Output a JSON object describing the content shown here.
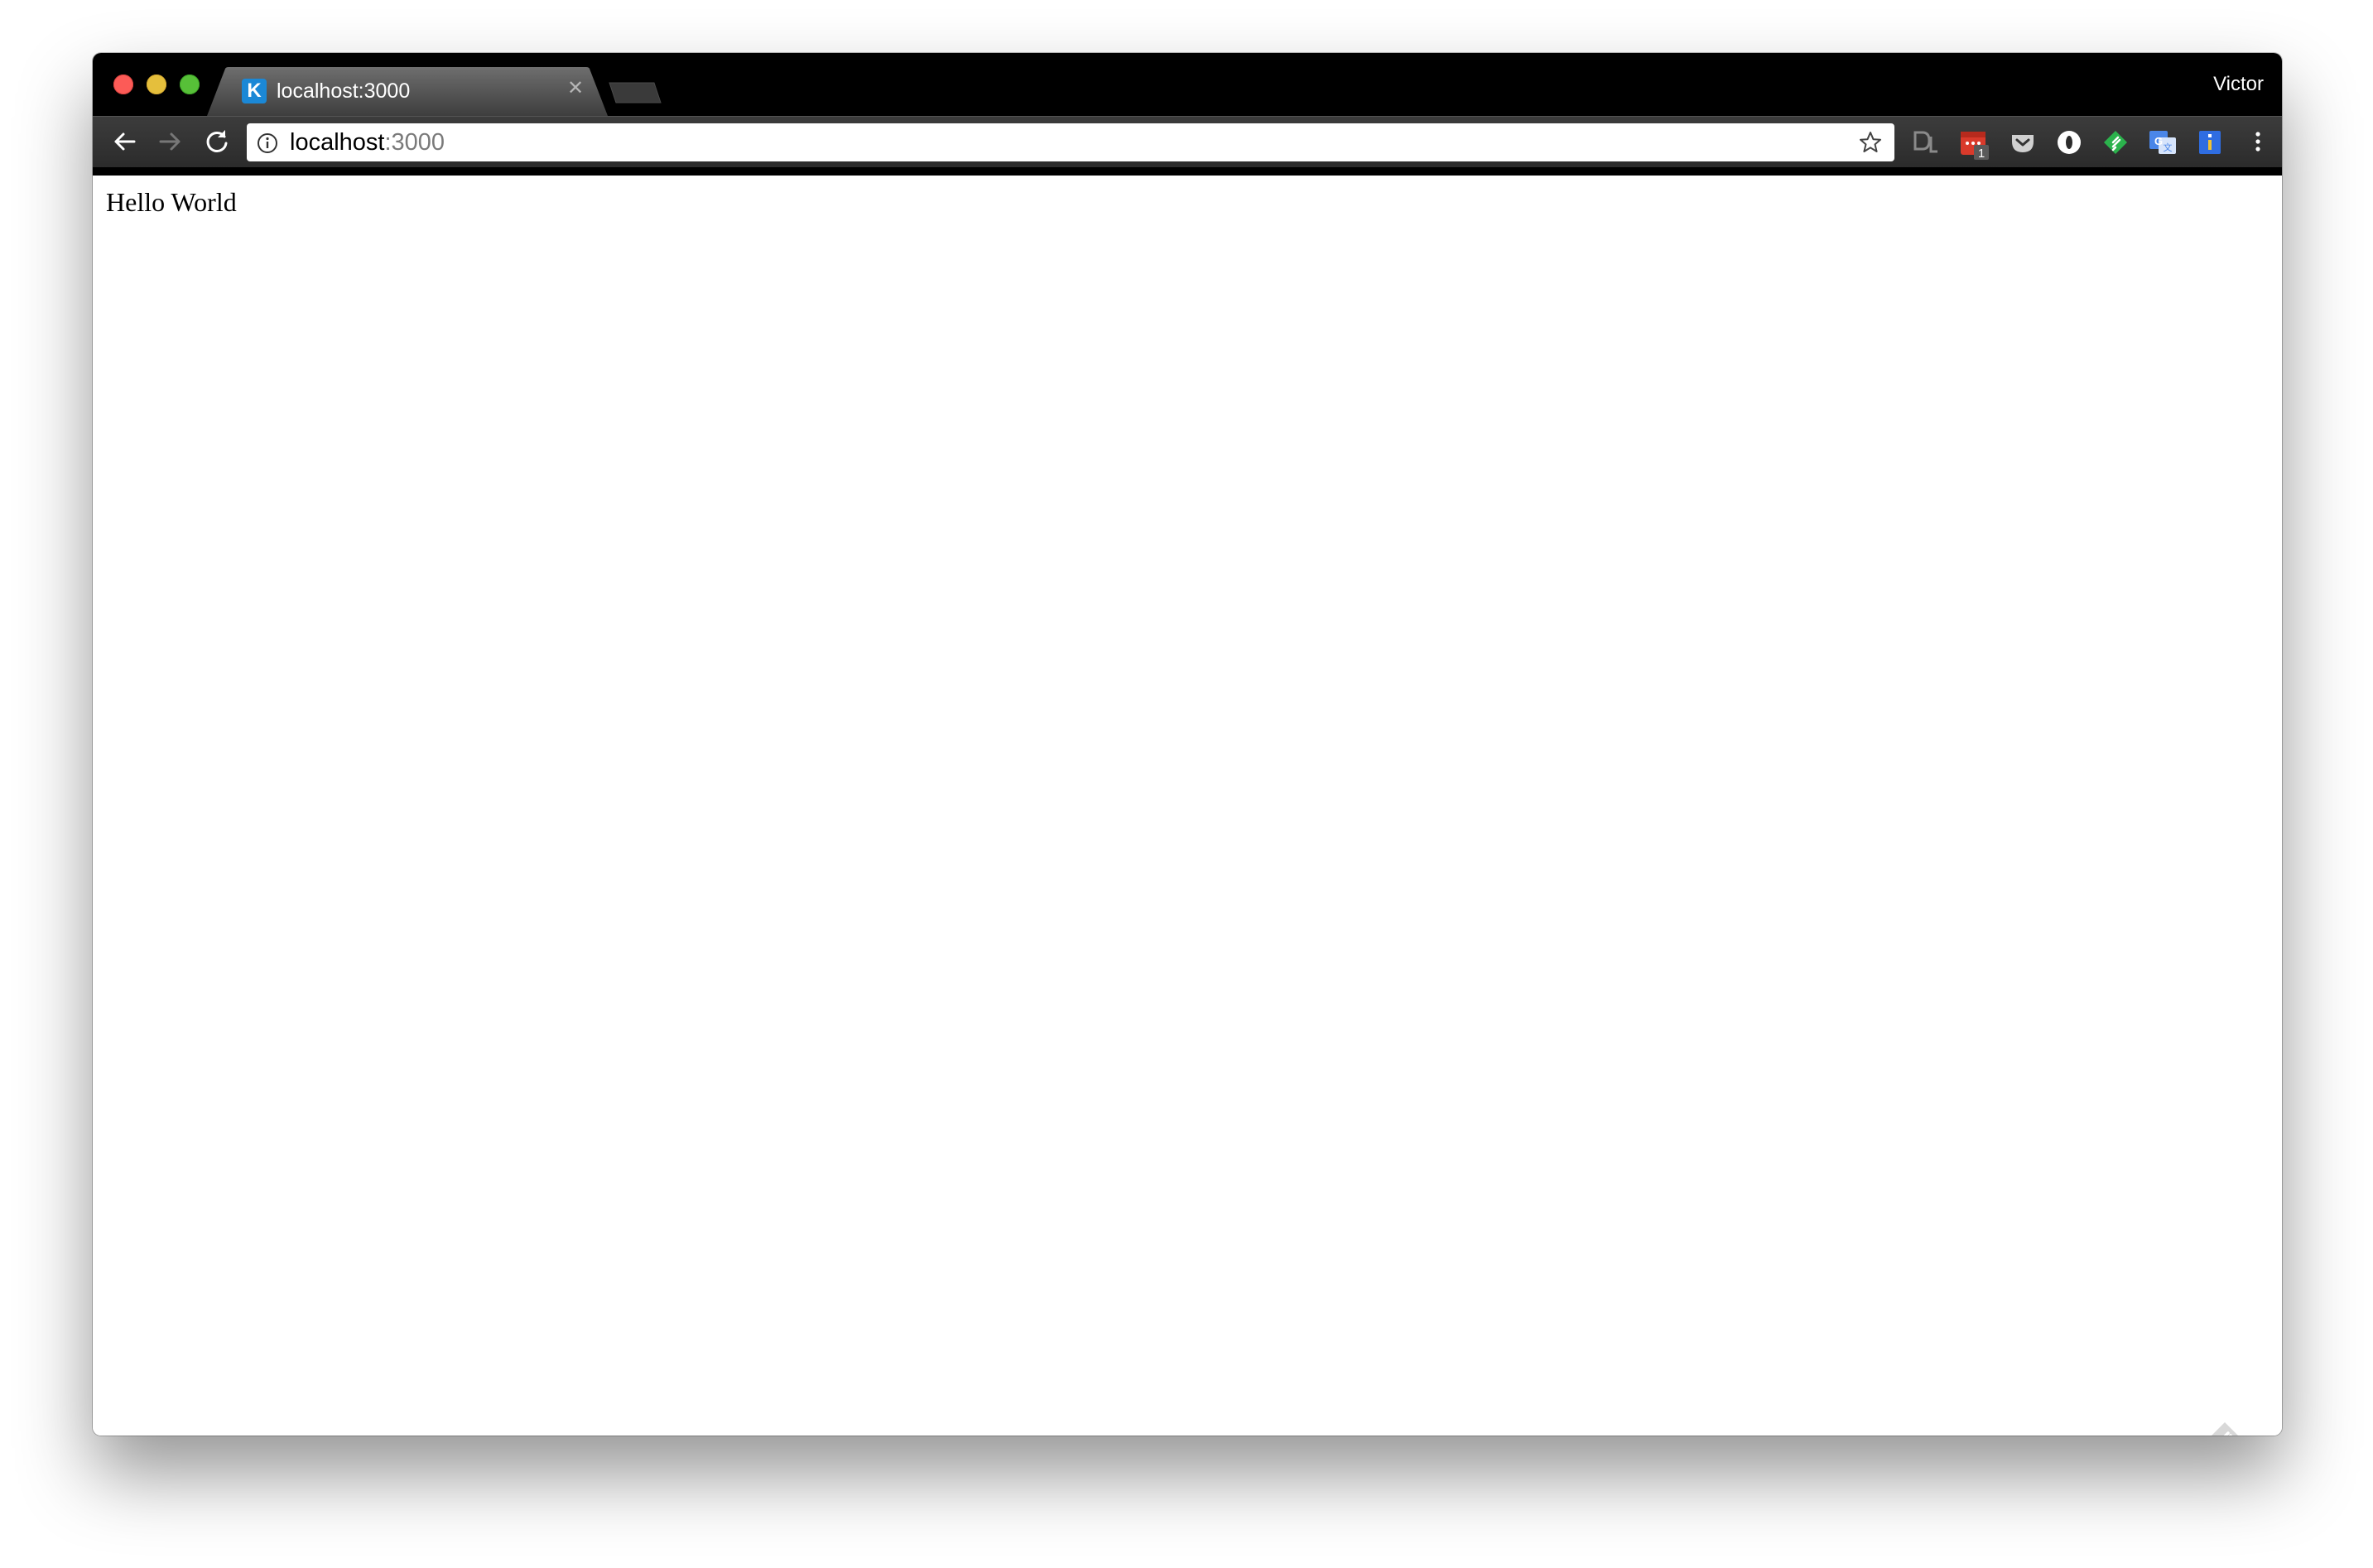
{
  "window": {
    "profile_name": "Victor"
  },
  "tabs": [
    {
      "title": "localhost:3000",
      "favicon_letter": "K",
      "favicon_color": "#1b88d6",
      "active": true
    }
  ],
  "toolbar": {
    "back_icon": "arrow-left-icon",
    "forward_icon": "arrow-right-icon",
    "reload_icon": "reload-icon",
    "omnibox": {
      "host": "localhost",
      "port": ":3000",
      "info_icon": "info-icon",
      "bookmark_icon": "star-icon"
    },
    "extensions": [
      {
        "name": "dl-extension-icon"
      },
      {
        "name": "calendar-extension-icon",
        "badge": "1",
        "color": "#d93a2b"
      },
      {
        "name": "pocket-icon"
      },
      {
        "name": "circle-extension-icon"
      },
      {
        "name": "feedly-icon",
        "color": "#2bb24c"
      },
      {
        "name": "google-translate-icon",
        "color": "#4a86e8"
      },
      {
        "name": "info-extension-icon",
        "color": "#2f6de1"
      }
    ],
    "menu_icon": "kebab-menu-icon"
  },
  "page": {
    "text": "Hello World"
  }
}
